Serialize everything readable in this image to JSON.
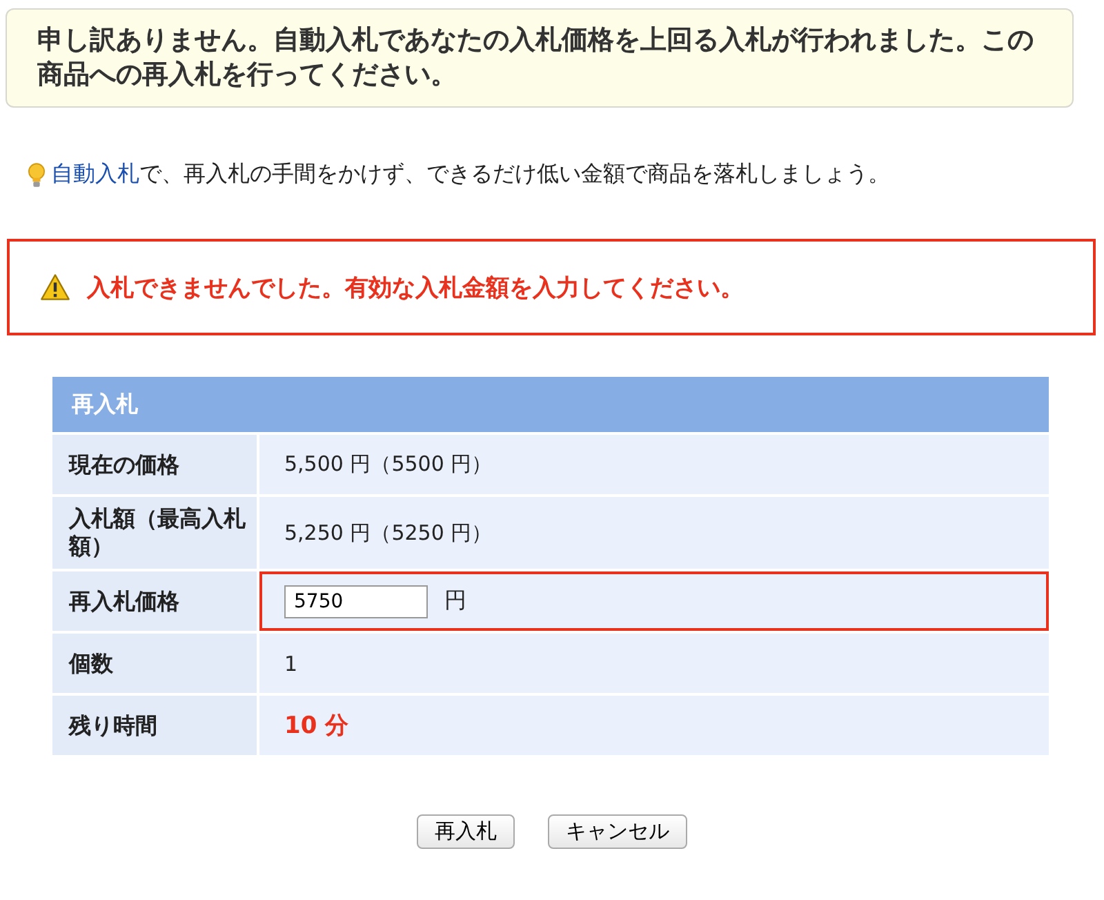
{
  "notice": "申し訳ありません。自動入札であなたの入札価格を上回る入札が行われました。この商品への再入札を行ってください。",
  "tip": {
    "link": "自動入札",
    "text": "で、再入札の手間をかけず、できるだけ低い金額で商品を落札しましょう。"
  },
  "error": "入札できませんでした。有効な入札金額を入力してください。",
  "table": {
    "title": "再入札",
    "rows": [
      {
        "kind": "text",
        "label": "現在の価格",
        "value": "5,500 円（5500 円）",
        "highlighted": false
      },
      {
        "kind": "text",
        "label": "入札額（最高入札額）",
        "value": "5,250 円（5250 円）",
        "highlighted": false
      },
      {
        "kind": "input",
        "label": "再入札価格",
        "value": "5750",
        "unit": "円",
        "highlighted": true
      },
      {
        "kind": "text",
        "label": "個数",
        "value": "1",
        "highlighted": false
      },
      {
        "kind": "alert",
        "label": "残り時間",
        "value": "10 分",
        "highlighted": false
      }
    ]
  },
  "buttons": [
    "再入札",
    "キャンセル"
  ]
}
